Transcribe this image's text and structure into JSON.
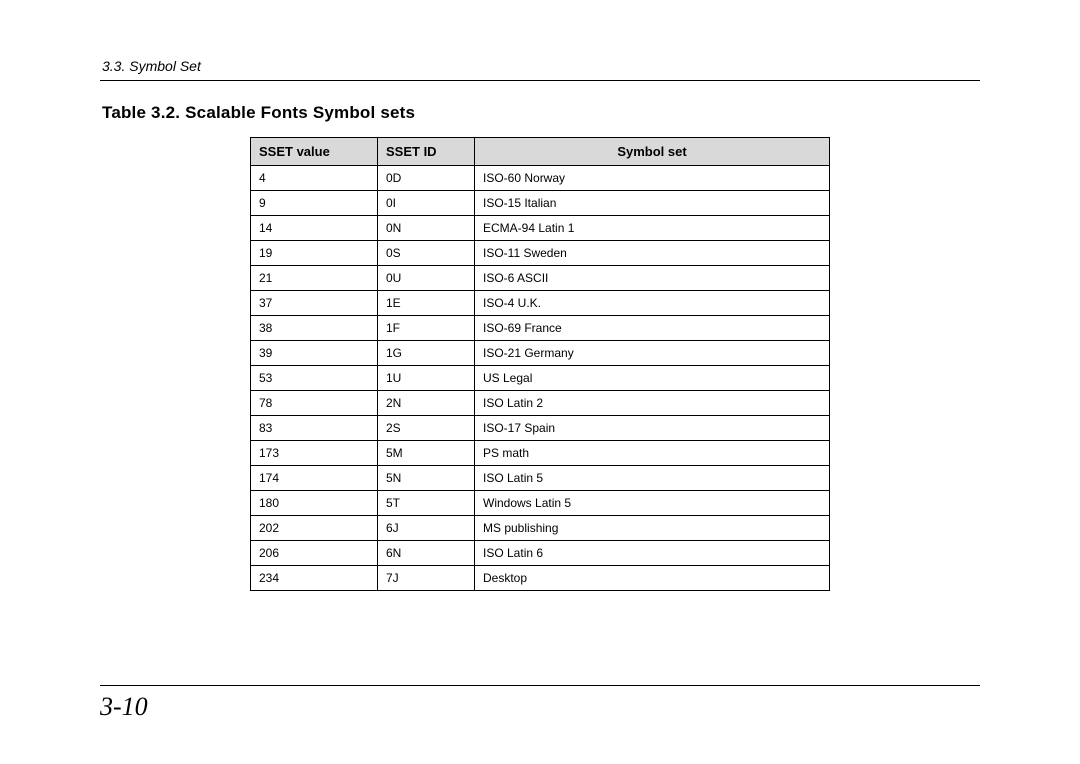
{
  "header": {
    "section_label": "3.3.  Symbol Set"
  },
  "title": "Table 3.2.  Scalable Fonts Symbol sets",
  "table": {
    "headers": {
      "sset_value": "SSET value",
      "sset_id": "SSET ID",
      "symbol_set": "Symbol set"
    },
    "rows": [
      {
        "value": "4",
        "id": "0D",
        "set": "ISO-60 Norway"
      },
      {
        "value": "9",
        "id": "0I",
        "set": "ISO-15 Italian"
      },
      {
        "value": "14",
        "id": "0N",
        "set": "ECMA-94 Latin 1"
      },
      {
        "value": "19",
        "id": "0S",
        "set": "ISO-11 Sweden"
      },
      {
        "value": "21",
        "id": "0U",
        "set": "ISO-6 ASCII"
      },
      {
        "value": "37",
        "id": "1E",
        "set": "ISO-4 U.K."
      },
      {
        "value": "38",
        "id": "1F",
        "set": "ISO-69 France"
      },
      {
        "value": "39",
        "id": "1G",
        "set": "ISO-21 Germany"
      },
      {
        "value": "53",
        "id": "1U",
        "set": "US Legal"
      },
      {
        "value": "78",
        "id": "2N",
        "set": "ISO Latin 2"
      },
      {
        "value": "83",
        "id": "2S",
        "set": "ISO-17 Spain"
      },
      {
        "value": "173",
        "id": "5M",
        "set": "PS math"
      },
      {
        "value": "174",
        "id": "5N",
        "set": "ISO Latin 5"
      },
      {
        "value": "180",
        "id": "5T",
        "set": "Windows Latin 5"
      },
      {
        "value": "202",
        "id": "6J",
        "set": "MS publishing"
      },
      {
        "value": "206",
        "id": "6N",
        "set": "ISO Latin 6"
      },
      {
        "value": "234",
        "id": "7J",
        "set": "Desktop"
      }
    ]
  },
  "page_number": "3-10"
}
